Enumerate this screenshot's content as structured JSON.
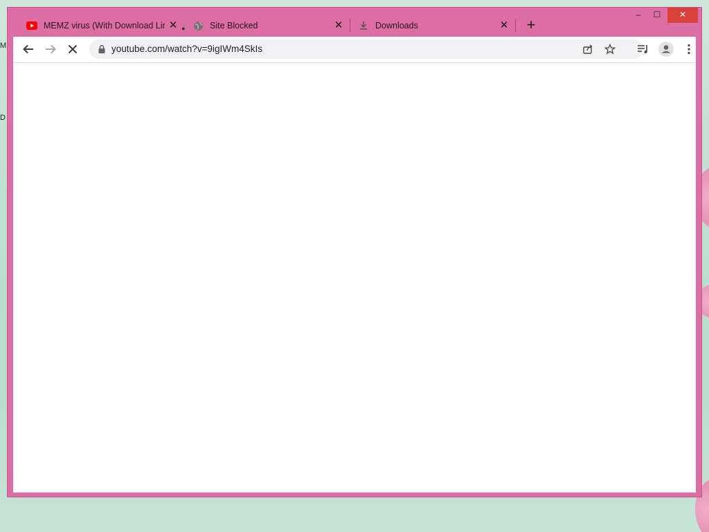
{
  "desktop": {
    "edge_icon_1_letter": "M",
    "edge_icon_2_letter": "D"
  },
  "tabs": [
    {
      "title": "MEMZ virus (With Download Link)",
      "favicon": "youtube-icon",
      "close": "✕"
    },
    {
      "title": "Site Blocked",
      "favicon": "globe-icon",
      "close": "✕"
    },
    {
      "title": "Downloads",
      "favicon": "download-icon",
      "close": "✕"
    }
  ],
  "new_tab_label": "+",
  "window_controls": {
    "minimize": "–",
    "maximize": "☐",
    "close": "✕"
  },
  "address_bar": {
    "url": "youtube.com/watch?v=9igIWm4SkIs"
  },
  "colors": {
    "frame": "#dd6ea4",
    "youtube_red": "#ff0000",
    "toolbar_bg": "#ffffff",
    "omnibox_bg": "#f1f1f3"
  }
}
